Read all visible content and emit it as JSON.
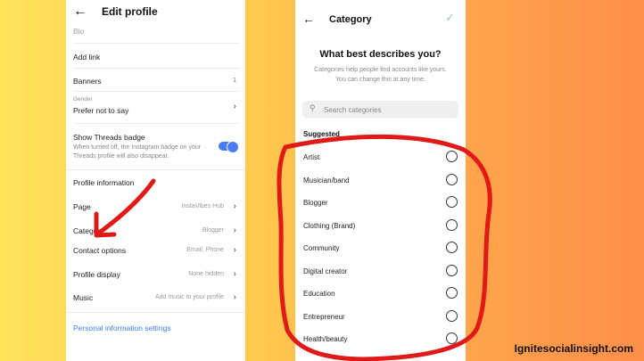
{
  "left_screen": {
    "title": "Edit profile",
    "bio_label": "Bio",
    "add_link": "Add link",
    "banners": {
      "label": "Banners",
      "count": "1"
    },
    "gender": {
      "label": "Gender",
      "value": "Prefer not to say"
    },
    "threads_badge": {
      "label": "Show Threads badge",
      "description": "When turned off, the Instagram badge on your Threads profile will also disappear."
    },
    "section_title": "Profile information",
    "rows": [
      {
        "label": "Page",
        "value": "InstaVibes Hub"
      },
      {
        "label": "Category",
        "value": "Blogger"
      },
      {
        "label": "Contact options",
        "value": "Email, Phone"
      },
      {
        "label": "Profile display",
        "value": "None hidden"
      },
      {
        "label": "Music",
        "value": "Add music to your profile"
      }
    ],
    "personal_info_link": "Personal information settings"
  },
  "right_screen": {
    "title": "Category",
    "question": "What best describes you?",
    "subtitle_line1": "Categories help people find accounts like yours.",
    "subtitle_line2": "You can change this at any time.",
    "search_placeholder": "Search categories",
    "suggested_label": "Suggested",
    "categories": [
      "Artist",
      "Musician/band",
      "Blogger",
      "Clothing (Brand)",
      "Community",
      "Digital creator",
      "Education",
      "Entrepreneur",
      "Health/beauty"
    ]
  },
  "watermark": "Ignitesocialinsight.com",
  "colors": {
    "annotation": "#e01919",
    "accent_blue": "#3b82f6",
    "toggle_blue": "#4a7cf5"
  },
  "icons": {
    "back": "arrow-left",
    "chevron": "chevron-right",
    "confirm": "check",
    "search": "magnifier"
  }
}
